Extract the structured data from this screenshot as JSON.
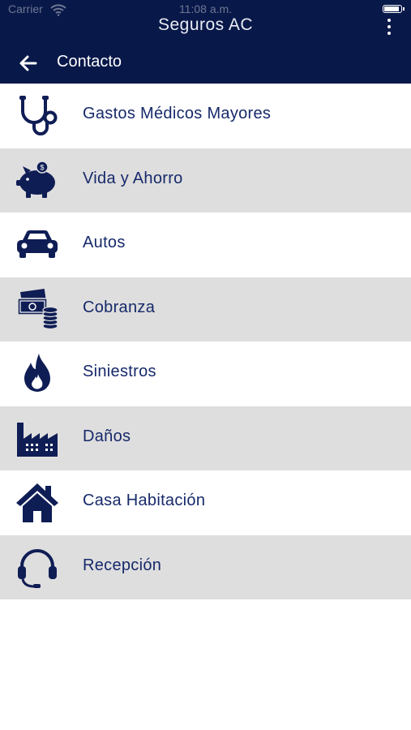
{
  "status_bar": {
    "carrier": "Carrier",
    "time": "11:08 a.m."
  },
  "app_bar": {
    "title": "Seguros AC"
  },
  "nav_bar": {
    "title": "Contacto"
  },
  "colors": {
    "primary": "#081849",
    "text": "#16296a",
    "alt_row": "#dedede",
    "icon": "#0f1d55"
  },
  "menu": {
    "items": [
      {
        "label": "Gastos Médicos Mayores",
        "icon": "stethoscope-icon"
      },
      {
        "label": "Vida y Ahorro",
        "icon": "piggy-bank-icon"
      },
      {
        "label": "Autos",
        "icon": "car-icon"
      },
      {
        "label": "Cobranza",
        "icon": "money-coins-icon"
      },
      {
        "label": "Siniestros",
        "icon": "fire-icon"
      },
      {
        "label": "Daños",
        "icon": "factory-icon"
      },
      {
        "label": "Casa Habitación",
        "icon": "house-icon"
      },
      {
        "label": "Recepción",
        "icon": "headset-icon"
      }
    ]
  }
}
